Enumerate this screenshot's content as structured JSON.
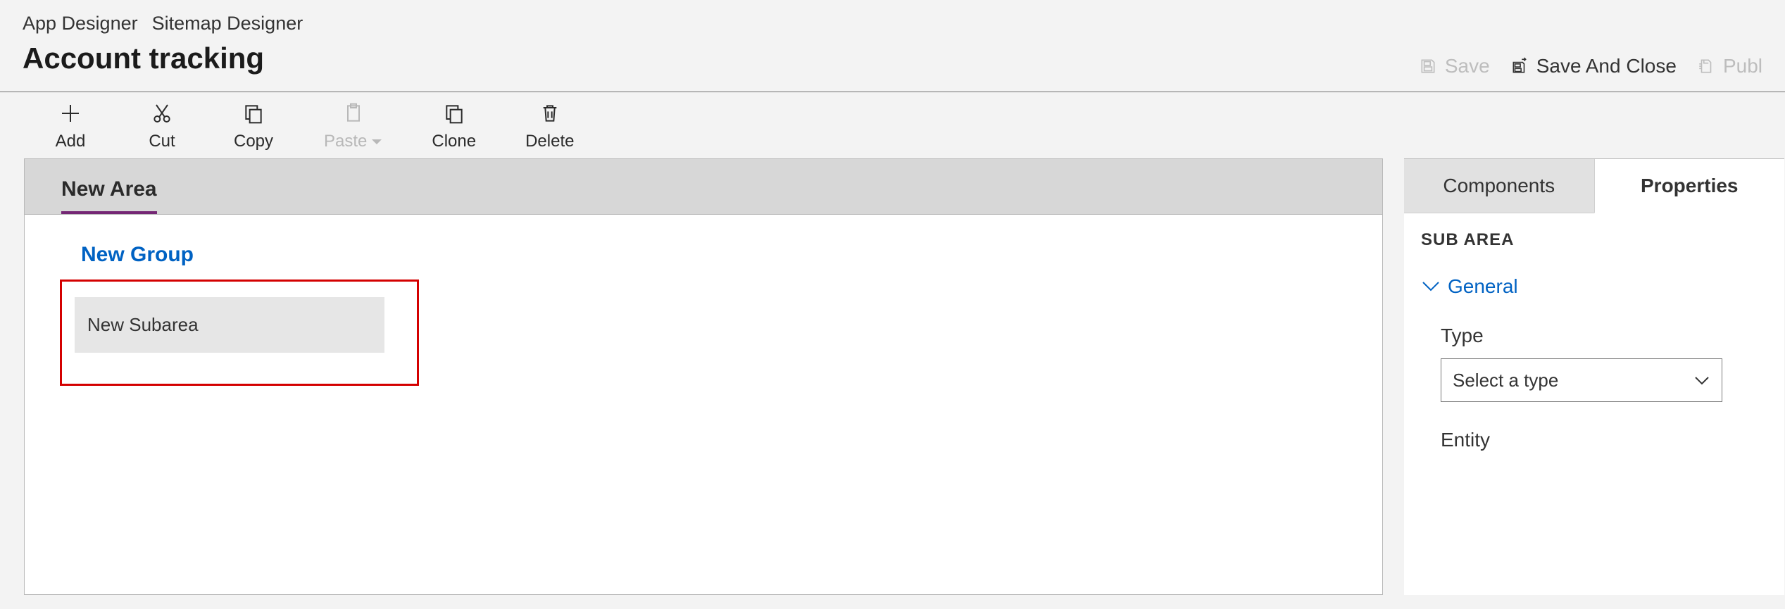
{
  "breadcrumb": {
    "app": "App Designer",
    "page": "Sitemap Designer"
  },
  "page_title": "Account tracking",
  "header_actions": {
    "save": "Save",
    "save_and_close": "Save And Close",
    "publish": "Publ"
  },
  "toolbar": {
    "add": "Add",
    "cut": "Cut",
    "copy": "Copy",
    "paste": "Paste",
    "clone": "Clone",
    "delete": "Delete"
  },
  "sitemap": {
    "areas": [
      {
        "label": "New Area",
        "selected": true
      }
    ],
    "group_label": "New Group",
    "subarea_label": "New Subarea"
  },
  "panel": {
    "tabs": {
      "components": "Components",
      "properties": "Properties"
    },
    "heading": "SUB AREA",
    "section_general": "General",
    "type_label": "Type",
    "type_placeholder": "Select a type",
    "entity_label": "Entity"
  }
}
